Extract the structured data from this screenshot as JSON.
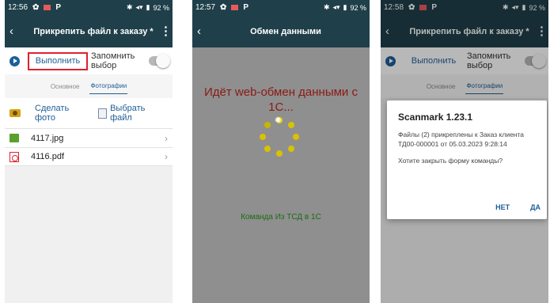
{
  "screen1": {
    "status": {
      "time": "12:56",
      "battery": "92 %"
    },
    "title": "Прикрепить файл к заказу *",
    "run_label": "Выполнить",
    "remember_label": "Запомнить выбор",
    "tabs": [
      "Основное",
      "Фотографии"
    ],
    "take_photo_label": "Сделать фото",
    "choose_file_label": "Выбрать файл",
    "files": [
      {
        "name": "4117.jpg",
        "icon": "image-file-icon"
      },
      {
        "name": "4116.pdf",
        "icon": "pdf-file-icon"
      }
    ]
  },
  "screen2": {
    "status": {
      "time": "12:57",
      "battery": "92 %"
    },
    "title": "Обмен данными",
    "progress_text": "Идёт web-обмен данными с 1С...",
    "direction_text": "Команда  Из  ТСД в 1С"
  },
  "screen3": {
    "status": {
      "time": "12:58",
      "battery": "92 %"
    },
    "title": "Прикрепить файл к заказу *",
    "run_label": "Выполнить",
    "remember_label": "Запомнить выбор",
    "tabs": [
      "Основное",
      "Фотографии"
    ],
    "dialog": {
      "title": "Scanmark 1.23.1",
      "message": "Файлы (2) прикреплены к Заказ клиента ТД00-000001 от 05.03.2023 9:28:14",
      "question": "Хотите закрыть форму команды?",
      "no_label": "НЕТ",
      "yes_label": "ДА"
    }
  },
  "colors": {
    "header": "#1f3f4a",
    "accent": "#1f5e96",
    "highlight": "#e0202f",
    "progress_text": "#8b1a14",
    "direction_text": "#1b6b14"
  }
}
